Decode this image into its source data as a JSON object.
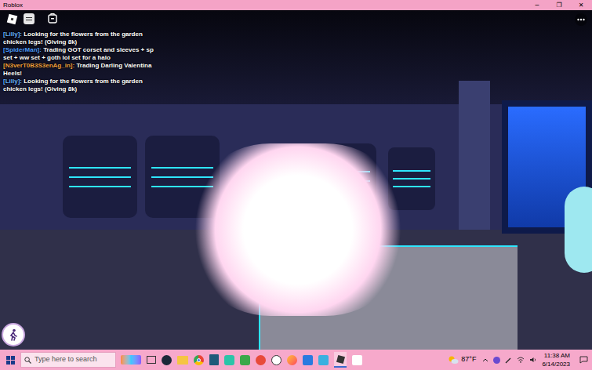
{
  "window": {
    "title": "Roblox",
    "controls": [
      "─",
      "❐",
      "✕"
    ]
  },
  "chat": {
    "messages": [
      {
        "user": "[Lilly]:",
        "text": "Looking for the flowers from the garden chicken legs! (Giving 8k)",
        "color": "#66b3ff"
      },
      {
        "user": "[SpiderMan]:",
        "text": "Trading GOT corset and sleeves + sp set + ww set + goth lol set for a halo",
        "color": "#4f9dff"
      },
      {
        "user": "[N3verT0B3S3enAg_in]:",
        "text": "Trading Darling Valentina Heels!",
        "color": "#f0a040"
      },
      {
        "user": "[Lilly]:",
        "text": "Looking for the flowers from the garden chicken legs! (Giving 8k)",
        "color": "#66b3ff"
      }
    ]
  },
  "taskbar": {
    "search": {
      "placeholder": "Type here to search"
    },
    "weather": "87°F",
    "time": "11:38 AM",
    "date": "6/14/2023"
  }
}
